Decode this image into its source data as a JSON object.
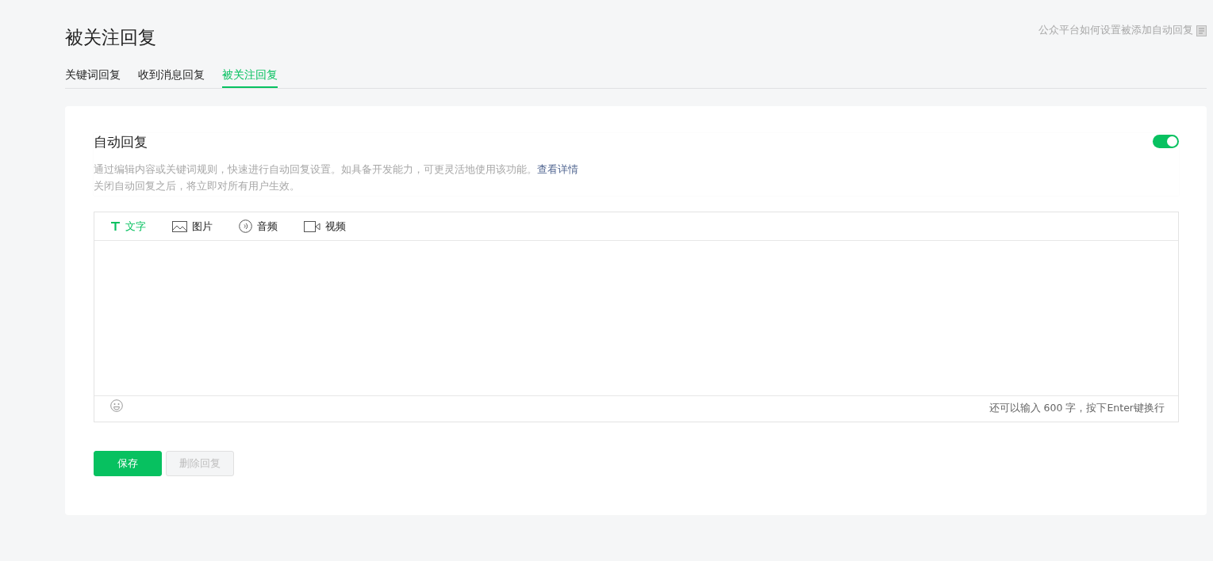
{
  "page": {
    "title": "被关注回复",
    "help_link": "公众平台如何设置被添加自动回复"
  },
  "tabs": [
    {
      "label": "关键词回复",
      "selected": false
    },
    {
      "label": "收到消息回复",
      "selected": false
    },
    {
      "label": "被关注回复",
      "selected": true
    }
  ],
  "auto_reply": {
    "title": "自动回复",
    "on": true,
    "description": "通过编辑内容或关键词规则，快速进行自动回复设置。如具备开发能力，可更灵活地使用该功能。",
    "details_link": "查看详情",
    "note": "关闭自动回复之后，将立即对所有用户生效。"
  },
  "editor": {
    "types": [
      {
        "kind": "text",
        "label": "文字",
        "selected": true
      },
      {
        "kind": "image",
        "label": "图片",
        "selected": false
      },
      {
        "kind": "audio",
        "label": "音频",
        "selected": false
      },
      {
        "kind": "video",
        "label": "视频",
        "selected": false
      }
    ],
    "counter": "还可以输入 600 字，按下Enter键换行"
  },
  "buttons": [
    {
      "label": "保存",
      "disabled": false
    },
    {
      "label": "删除回复",
      "disabled": true
    }
  ]
}
